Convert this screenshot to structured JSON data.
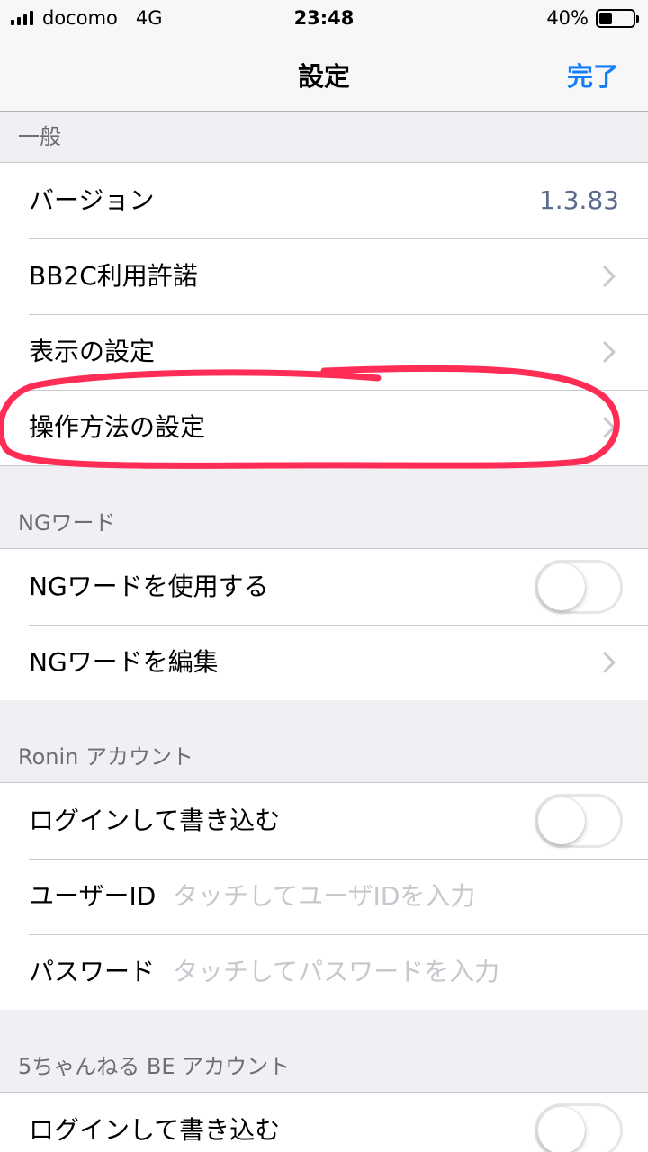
{
  "status_bar": {
    "carrier": "docomo",
    "network": "4G",
    "time": "23:48",
    "battery_percent": "40%",
    "battery_level": 0.4
  },
  "nav": {
    "title": "設定",
    "done_label": "完了",
    "accent_color": "#147efb"
  },
  "sections": {
    "general": {
      "header": "一般",
      "version_label": "バージョン",
      "version_value": "1.3.83",
      "license_label": "BB2C利用許諾",
      "display_settings_label": "表示の設定",
      "operation_settings_label": "操作方法の設定"
    },
    "ng_word": {
      "header": "NGワード",
      "use_label": "NGワードを使用する",
      "use_enabled": false,
      "edit_label": "NGワードを編集"
    },
    "ronin": {
      "header": "Ronin アカウント",
      "login_label": "ログインして書き込む",
      "login_enabled": false,
      "user_id_label": "ユーザーID",
      "user_id_placeholder": "タッチしてユーザIDを入力",
      "password_label": "パスワード",
      "password_placeholder": "タッチしてパスワードを入力"
    },
    "be": {
      "header": "5ちゃんねる BE アカウント",
      "login_label": "ログインして書き込む",
      "login_enabled": false
    }
  },
  "annotation": {
    "color": "#ff2d55",
    "target": "操作方法の設定"
  }
}
